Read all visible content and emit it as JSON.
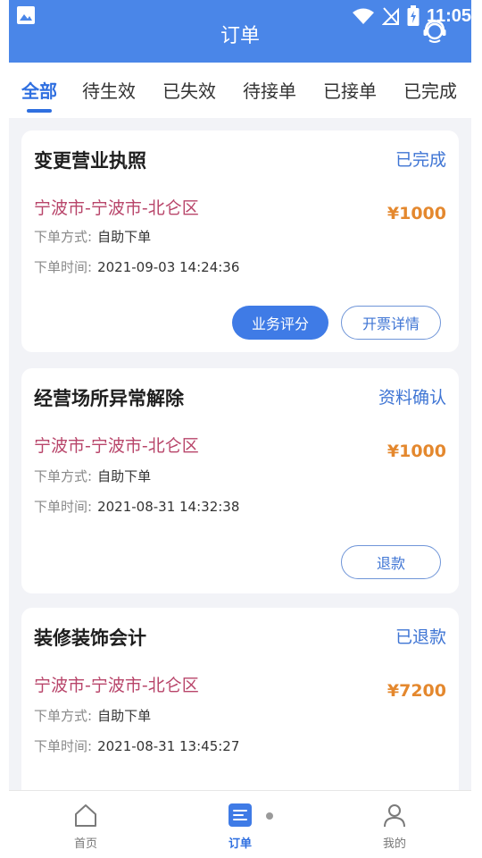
{
  "status_bar": {
    "time": "11:05",
    "icons": [
      "image-icon",
      "wifi-icon",
      "no-signal-icon",
      "battery-charging-icon"
    ]
  },
  "header": {
    "title": "订单",
    "action_icon": "support-headset-icon"
  },
  "tabs": [
    {
      "label": "全部",
      "active": true
    },
    {
      "label": "待生效",
      "active": false
    },
    {
      "label": "已失效",
      "active": false
    },
    {
      "label": "待接单",
      "active": false
    },
    {
      "label": "已接单",
      "active": false
    },
    {
      "label": "已完成",
      "active": false
    }
  ],
  "orders": [
    {
      "title": "变更营业执照",
      "status": "已完成",
      "location": "宁波市-宁波市-北仑区",
      "price": "¥1000",
      "method_label": "下单方式:",
      "method_value": "自助下单",
      "time_label": "下单时间:",
      "time_value": "2021-09-03 14:24:36",
      "buttons": [
        "业务评分",
        "开票详情"
      ]
    },
    {
      "title": "经营场所异常解除",
      "status": "资料确认",
      "location": "宁波市-宁波市-北仑区",
      "price": "¥1000",
      "method_label": "下单方式:",
      "method_value": "自助下单",
      "time_label": "下单时间:",
      "time_value": "2021-08-31 14:32:38",
      "buttons": [
        "退款"
      ]
    },
    {
      "title": "装修装饰会计",
      "status": "已退款",
      "location": "宁波市-宁波市-北仑区",
      "price": "¥7200",
      "method_label": "下单方式:",
      "method_value": "自助下单",
      "time_label": "下单时间:",
      "time_value": "2021-08-31 13:45:27",
      "buttons": []
    }
  ],
  "bottom_nav": [
    {
      "label": "首页",
      "icon": "home-icon",
      "active": false
    },
    {
      "label": "订单",
      "icon": "orders-icon",
      "active": true
    },
    {
      "label": "我的",
      "icon": "profile-icon",
      "active": false
    }
  ],
  "colors": {
    "primary": "#4a86e8",
    "active_tab": "#2f6fe0",
    "status_text": "#3f75d4",
    "location_text": "#b8456a",
    "price_text": "#e4882e"
  }
}
